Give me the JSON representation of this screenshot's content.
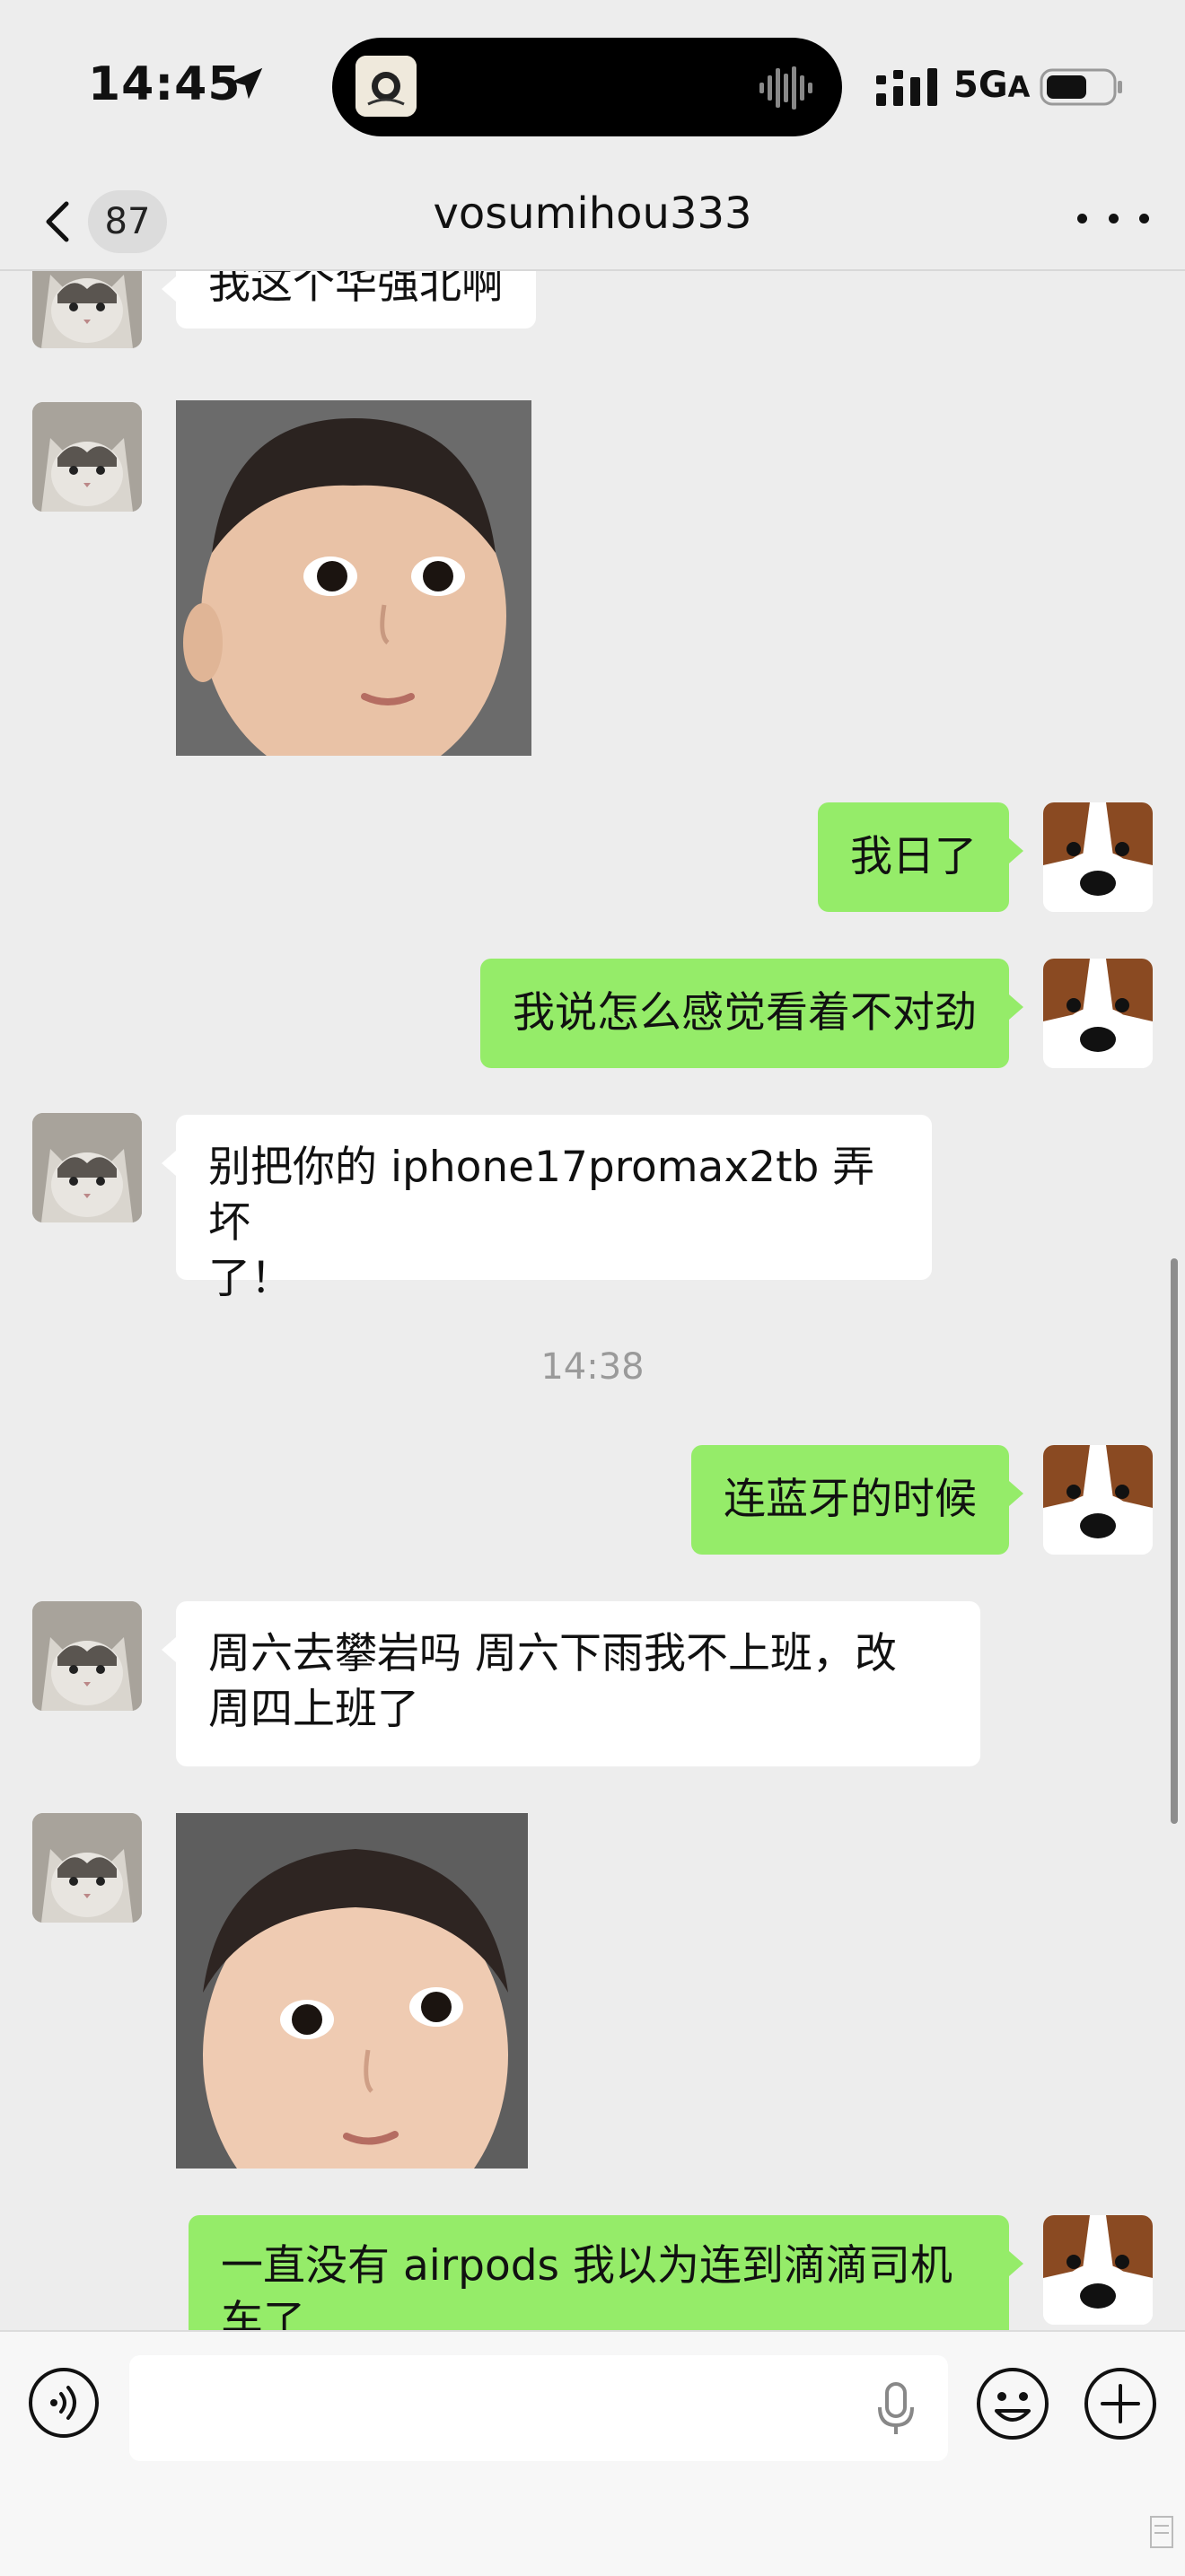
{
  "status_bar": {
    "time": "14:45",
    "location_icon": "location-arrow-icon",
    "network": "5G",
    "network_suffix": "A",
    "battery_icon": "battery-icon",
    "signal_icon": "signal-icon"
  },
  "nav": {
    "back_icon": "chevron-left-icon",
    "unread_count": "87",
    "title": "vosumihou333",
    "more_icon": "more-dots-icon"
  },
  "messages": [
    {
      "side": "in",
      "type": "text",
      "text": "我这个华强北啊"
    },
    {
      "side": "in",
      "type": "sticker",
      "sticker": "baby-face-sticker"
    },
    {
      "side": "out",
      "type": "text",
      "text": "我日了"
    },
    {
      "side": "out",
      "type": "text",
      "text": "我说怎么感觉看着不对劲"
    },
    {
      "side": "in",
      "type": "text",
      "text_line1": "别把你的 iphone17promax2tb 弄坏",
      "text_line2": "了！"
    },
    {
      "type": "timestamp",
      "text": "14:38"
    },
    {
      "side": "out",
      "type": "text",
      "text": "连蓝牙的时候"
    },
    {
      "side": "in",
      "type": "text",
      "text_line1": "周六去攀岩吗 周六下雨我不上班，改",
      "text_line2": "周四上班了"
    },
    {
      "side": "in",
      "type": "sticker",
      "sticker": "baby-face-sticker"
    },
    {
      "side": "out",
      "type": "text",
      "text_line1": "一直没有 airpods 我以为连到滴滴司机",
      "text_line2": "车了"
    }
  ],
  "avatars": {
    "incoming": "cat-avatar",
    "outgoing": "dog-avatar"
  },
  "input_bar": {
    "voice_icon": "voice-icon",
    "mic_icon": "microphone-icon",
    "emoji_icon": "emoji-icon",
    "plus_icon": "plus-icon"
  },
  "colors": {
    "background": "#ededed",
    "outgoing_bubble": "#95ec69",
    "incoming_bubble": "#ffffff",
    "timestamp": "#9a9a9a"
  }
}
